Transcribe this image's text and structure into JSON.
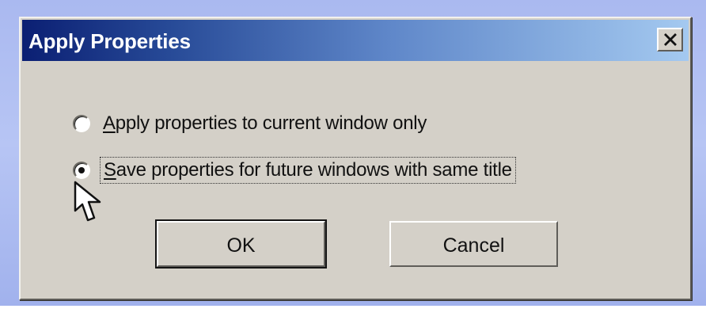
{
  "dialog": {
    "title": "Apply Properties",
    "close_icon": "close-icon"
  },
  "options": [
    {
      "label_prefix": "",
      "label_underlined": "A",
      "label_suffix": "pply properties to current window only",
      "selected": false
    },
    {
      "label_prefix": "",
      "label_underlined": "S",
      "label_suffix": "ave properties for future windows with same title",
      "selected": true
    }
  ],
  "buttons": {
    "ok_label": "OK",
    "cancel_label": "Cancel"
  },
  "icons": {
    "cursor": "mouse-pointer-icon"
  },
  "colors": {
    "dialog_face": "#d4d0c8",
    "titlebar_start": "#0b1f73",
    "titlebar_end": "#a4c9f0",
    "page_background": "#aab9f0"
  }
}
